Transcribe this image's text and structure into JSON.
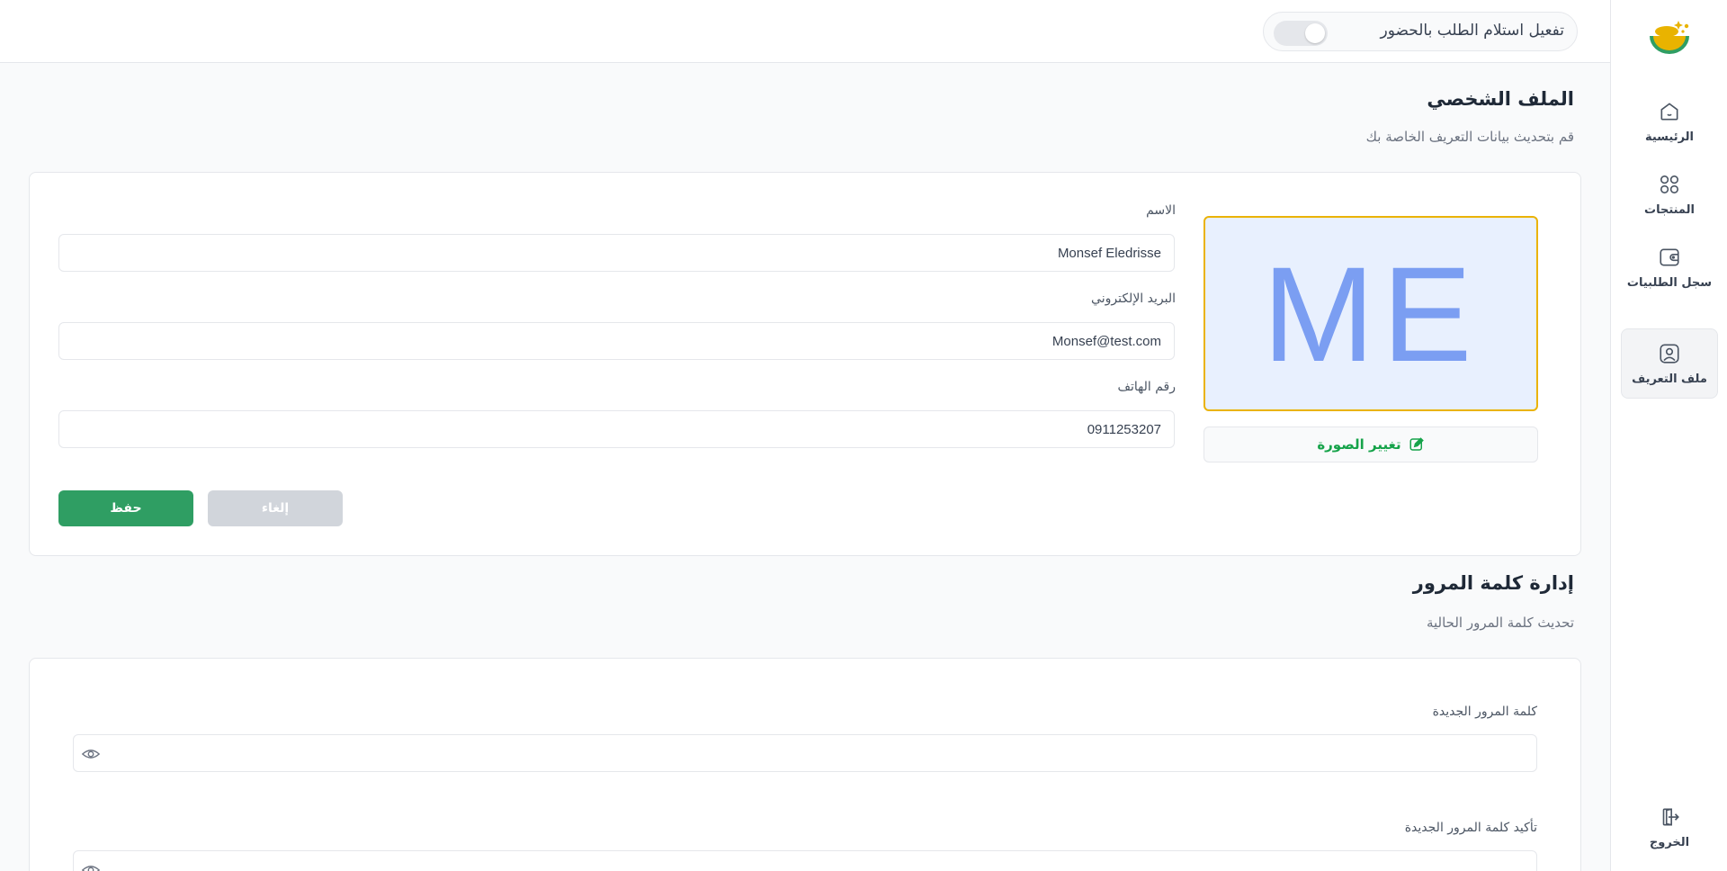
{
  "sidebar": {
    "items": [
      {
        "label": "الرئيسية",
        "icon": "home-icon"
      },
      {
        "label": "المنتجات",
        "icon": "grid-icon"
      },
      {
        "label": "سجل الطلبيات",
        "icon": "wallet-icon"
      },
      {
        "label": "ملف التعريف",
        "icon": "user-square-icon",
        "active": true
      }
    ],
    "logout_label": "الخروج"
  },
  "topbar": {
    "pickup_toggle_label": "تفعيل استلام الطلب بالحضور",
    "pickup_enabled": false
  },
  "profile": {
    "title": "الملف الشخصي",
    "subtitle": "قم بتحديث بيانات التعريف الخاصة بك",
    "avatar_initials": "ME",
    "change_photo_label": "تغيير الصورة",
    "name_label": "الاسم",
    "name_value": "Monsef Eledrisse",
    "email_label": "البريد الإلكتروني",
    "email_value": "Monsef@test.com",
    "phone_label": "رقم الهاتف",
    "phone_value": "0911253207",
    "cancel_label": "إلغاء",
    "save_label": "حفظ"
  },
  "password": {
    "title": "إدارة كلمة المرور",
    "subtitle": "تحديث كلمة المرور الحالية",
    "new_label": "كلمة المرور الجديدة",
    "confirm_label": "تأكيد كلمة المرور الجديدة"
  },
  "colors": {
    "accent_green": "#2f9e63",
    "avatar_border": "#eab308",
    "avatar_bg": "#e8f0fe",
    "avatar_text": "#7b9ef2"
  }
}
